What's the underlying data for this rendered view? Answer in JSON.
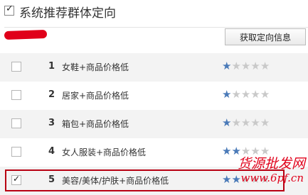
{
  "header": {
    "title": "系统推荐群体定向",
    "checked": true
  },
  "toolbar": {
    "fetch_label": "获取定向信息"
  },
  "rows": [
    {
      "num": "1",
      "label": "女鞋+商品价格低",
      "checked": false,
      "stars": 1,
      "max_stars": 5
    },
    {
      "num": "2",
      "label": "居家+商品价格低",
      "checked": false,
      "stars": 1,
      "max_stars": 5
    },
    {
      "num": "3",
      "label": "箱包+商品价格低",
      "checked": false,
      "stars": 1,
      "max_stars": 5
    },
    {
      "num": "4",
      "label": "女人服装+商品价格低",
      "checked": false,
      "stars": 2,
      "max_stars": 5
    },
    {
      "num": "5",
      "label": "美容/美体/护肤+商品价格低",
      "checked": true,
      "stars": 2,
      "max_stars": 5
    }
  ],
  "watermark": {
    "brand": "货源批发网",
    "url": "www.6pf.cn"
  },
  "colors": {
    "star_on": "#4a7ab8",
    "star_off": "#c9c9c9",
    "highlight": "#b80012",
    "watermark": "#e0001a"
  }
}
